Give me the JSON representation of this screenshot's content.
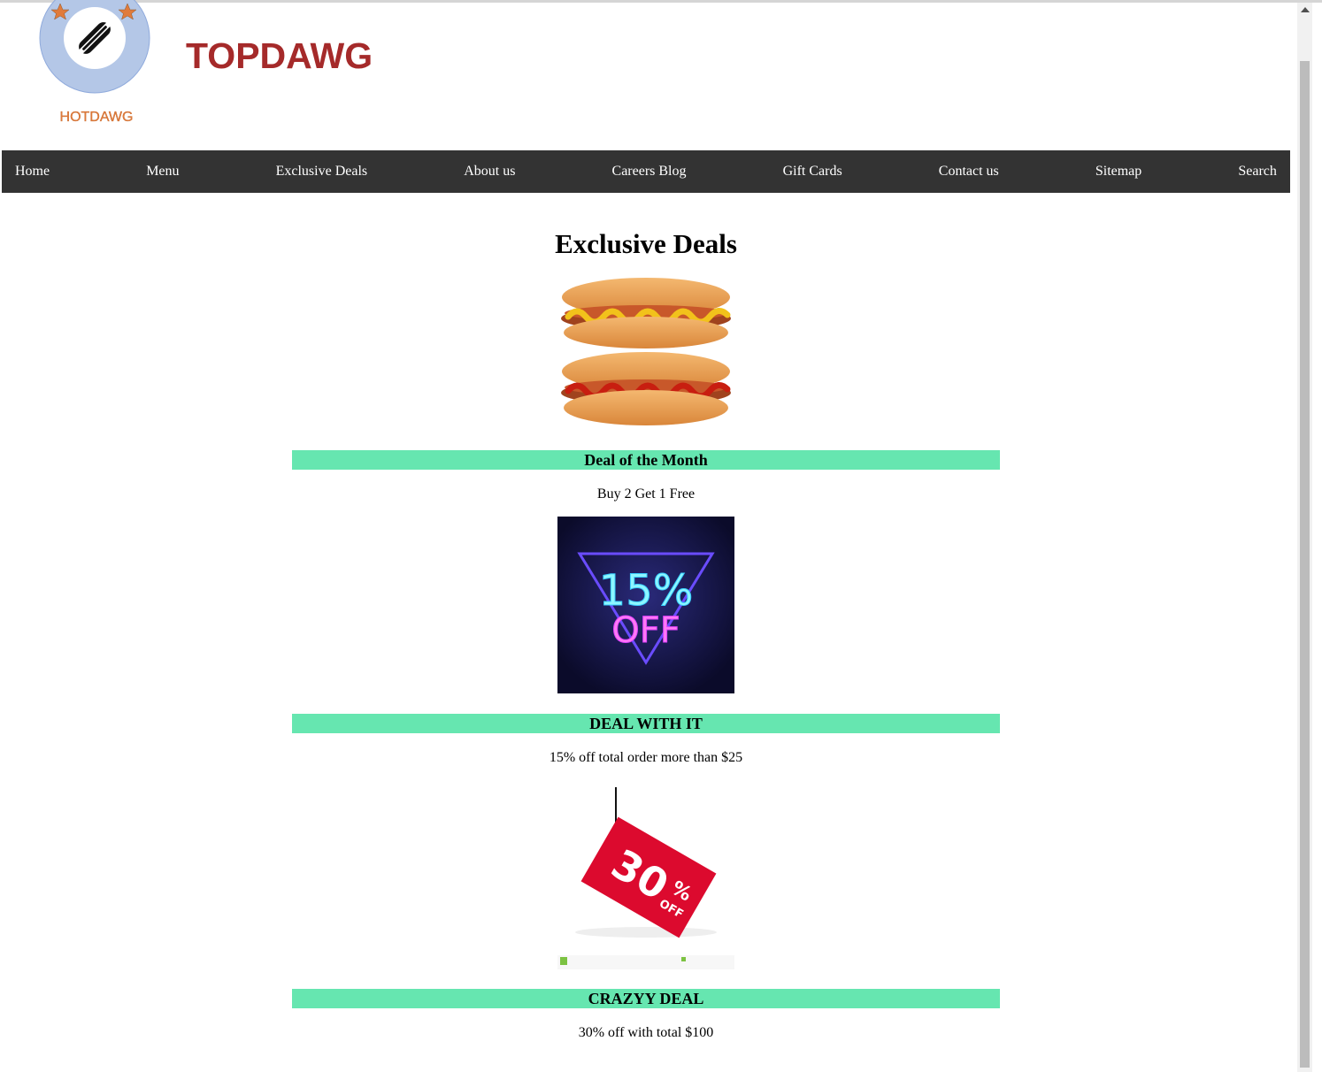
{
  "header": {
    "logo_text": "HOTDAWG",
    "site_title": "TOPDAWG"
  },
  "nav": {
    "items": [
      "Home",
      "Menu",
      "Exclusive Deals",
      "About us",
      "Careers Blog",
      "Gift Cards",
      "Contact us",
      "Sitemap",
      "Search"
    ]
  },
  "main": {
    "title": "Exclusive Deals",
    "deals": [
      {
        "heading": "Deal of the Month",
        "description": "Buy 2 Get 1 Free",
        "image": "hotdogs-image"
      },
      {
        "heading": "DEAL WITH IT",
        "description": "15% off total order more than $25",
        "image": "neon-sign-image",
        "image_text": [
          "15%",
          "OFF"
        ]
      },
      {
        "heading": "CRAZYY DEAL",
        "description": "30% off with total $100",
        "image": "price-tag-image",
        "image_text": [
          "30",
          "%",
          "OFF"
        ]
      }
    ]
  },
  "colors": {
    "brand_title": "#a52a2a",
    "nav_background": "#333333",
    "deal_heading_background": "#66e6b0",
    "logo_text": "#e07b3c"
  }
}
